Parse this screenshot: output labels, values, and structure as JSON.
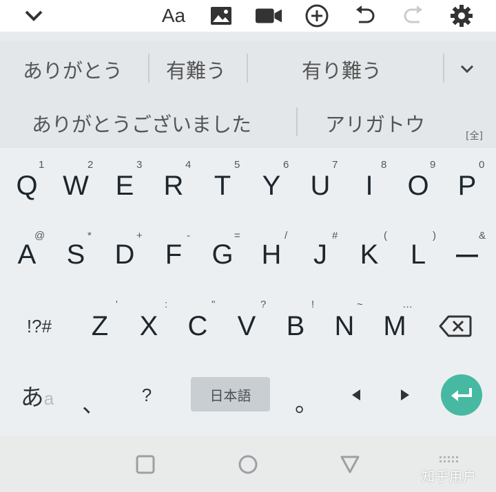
{
  "toolbar": {
    "icons": [
      "chevron-down-icon",
      "font-size-icon",
      "image-icon",
      "video-icon",
      "add-icon",
      "undo-icon",
      "redo-icon",
      "settings-icon"
    ],
    "font_label": "Aa"
  },
  "suggestions": {
    "row1": [
      "ありがとう",
      "有難う",
      "有り難う"
    ],
    "row2": [
      "ありがとうございました",
      "アリガトウ"
    ],
    "full_width_badge": "[全]"
  },
  "keyboard": {
    "row1": [
      {
        "key": "Q",
        "hint": "1"
      },
      {
        "key": "W",
        "hint": "2"
      },
      {
        "key": "E",
        "hint": "3"
      },
      {
        "key": "R",
        "hint": "4"
      },
      {
        "key": "T",
        "hint": "5"
      },
      {
        "key": "Y",
        "hint": "6"
      },
      {
        "key": "U",
        "hint": "7"
      },
      {
        "key": "I",
        "hint": "8"
      },
      {
        "key": "O",
        "hint": "9"
      },
      {
        "key": "P",
        "hint": "0"
      }
    ],
    "row2": [
      {
        "key": "A",
        "hint": "@"
      },
      {
        "key": "S",
        "hint": "*"
      },
      {
        "key": "D",
        "hint": "+"
      },
      {
        "key": "F",
        "hint": "-"
      },
      {
        "key": "G",
        "hint": "="
      },
      {
        "key": "H",
        "hint": "/"
      },
      {
        "key": "J",
        "hint": "#"
      },
      {
        "key": "K",
        "hint": "("
      },
      {
        "key": "L",
        "hint": ")"
      },
      {
        "key": "ー",
        "hint": "&"
      }
    ],
    "row3": [
      {
        "key": "Z",
        "hint": "'"
      },
      {
        "key": "X",
        "hint": ":"
      },
      {
        "key": "C",
        "hint": "\""
      },
      {
        "key": "V",
        "hint": "?"
      },
      {
        "key": "B",
        "hint": "!"
      },
      {
        "key": "N",
        "hint": "~"
      },
      {
        "key": "M",
        "hint": "…"
      }
    ],
    "symbols_label": "!?#",
    "kana_label": "あ",
    "alpha_label": "a",
    "comma_label": "、",
    "question_label": "?",
    "space_label": "日本語",
    "period_label": "。",
    "accent_color": "#47b9a3"
  },
  "nav": {
    "icons": [
      "recent-apps-icon",
      "home-icon",
      "back-icon",
      "keyboard-switch-icon"
    ]
  },
  "watermark": "知乎用户"
}
